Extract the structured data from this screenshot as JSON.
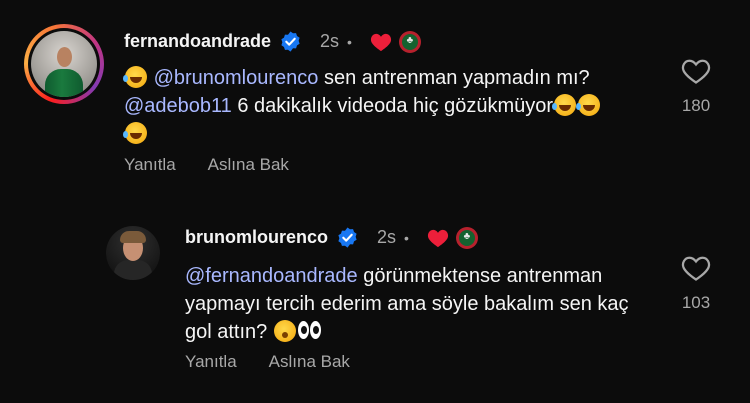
{
  "colors": {
    "background": "#0c0c0c",
    "mention": "#a9b8ff",
    "verified": "#1877f2",
    "heart_red": "#ed1f3a",
    "muted": "#a8a8a8"
  },
  "comments": [
    {
      "username": "fernandoandrade",
      "time": "2s",
      "dot": "•",
      "text_prefix_emoji": "face-with-tears-of-joy",
      "mention_1": "@brunomlourenco",
      "text_1": " sen antrenman yapmadın mı?",
      "mention_2": "@adebob11",
      "text_2": " 6 dakikalık videoda hiç gözükmüyor",
      "trailing_emojis": [
        "face-with-tears-of-joy",
        "face-with-tears-of-joy",
        "face-with-tears-of-joy"
      ],
      "reply_label": "Yanıtla",
      "translate_label": "Aslına Bak",
      "like_count": "180",
      "badge_text": "♣"
    },
    {
      "username": "brunomlourenco",
      "time": "2s",
      "dot": "•",
      "mention_1": "@fernandoandrade",
      "text_1": " görünmektense antrenman yapmayı tercih ederim ama söyle bakalım sen kaç gol attın? ",
      "trailing_emojis": [
        "hushed-face",
        "eyes"
      ],
      "reply_label": "Yanıtla",
      "translate_label": "Aslına Bak",
      "like_count": "103",
      "badge_text": "♣"
    }
  ]
}
